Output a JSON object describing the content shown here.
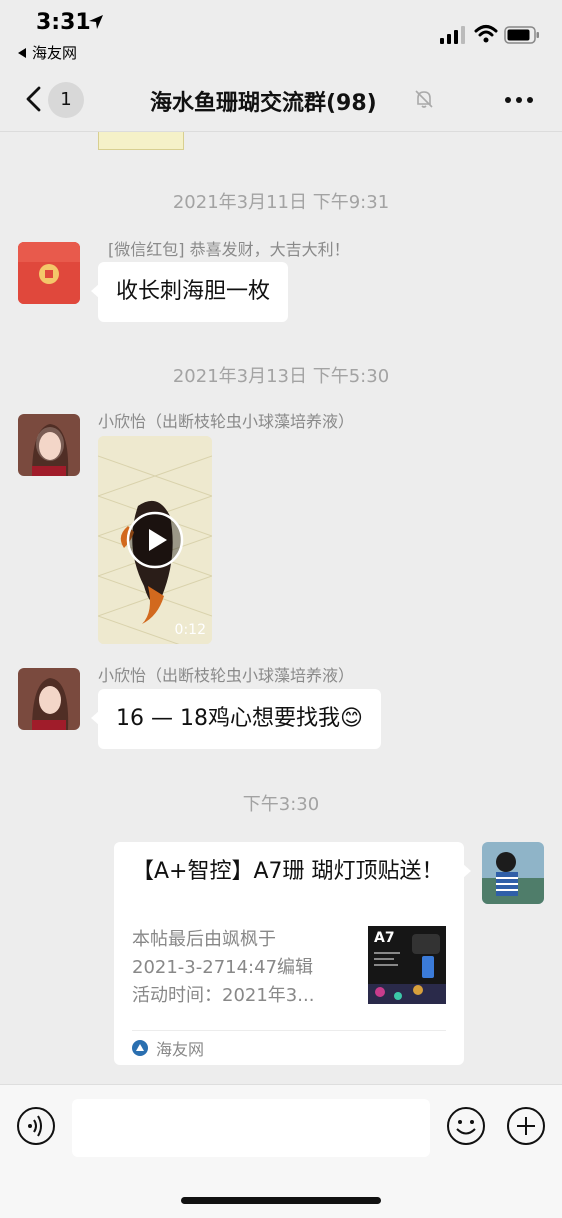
{
  "status_bar": {
    "time": "3:31",
    "back_app": "海友网"
  },
  "nav": {
    "unread_count": "1",
    "title": "海水鱼珊瑚交流群(98)"
  },
  "messages": {
    "ts1": "2021年3月11日 下午9:31",
    "redpacket_sender": "[微信红包] 恭喜发财，大吉大利！",
    "redpacket_text": "收长刺海胆一枚",
    "ts2": "2021年3月13日 下午5:30",
    "video_sender": "小欣怡（出断枝轮虫小球藻培养液）",
    "video_duration": "0:12",
    "text_sender": "小欣怡（出断枝轮虫小球藻培养液）",
    "text_body": "16 — 18鸡心想要找我😊",
    "ts3": "下午3:30"
  },
  "card": {
    "title": "【A+智控】A7珊 瑚灯顶贴送！",
    "desc_line1": "本帖最后由飒枫于",
    "desc_line2": "2021-3-2714:47编辑",
    "desc_line3": "活动时间：2021年3...",
    "thumb_text": "A7",
    "source": "海友网"
  },
  "input": {
    "value": ""
  },
  "colors": {
    "background": "#ededed",
    "bubble": "#ffffff",
    "red_packet": "#e0483c",
    "timestamp": "#a3a3a3"
  },
  "icons": {
    "back": "chevron-left-icon",
    "mute": "bell-off-icon",
    "more": "more-dots-icon",
    "voice": "voice-icon",
    "emoji": "emoji-icon",
    "plus": "plus-icon",
    "play": "play-icon",
    "source": "app-logo-icon"
  }
}
